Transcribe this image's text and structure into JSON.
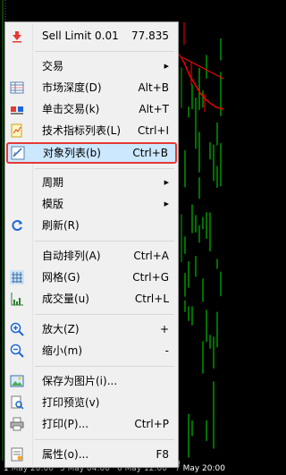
{
  "menu": {
    "items": [
      {
        "label": "Sell Limit 0.01",
        "shortcut": "77.835",
        "icon": "sell-limit-arrow-icon"
      },
      {
        "label": "交易",
        "submenu": true
      },
      {
        "label": "市场深度(D)",
        "shortcut": "Alt+B",
        "icon": "market-depth-icon"
      },
      {
        "label": "单击交易(k)",
        "shortcut": "Alt+T",
        "icon": "one-click-trading-icon"
      },
      {
        "label": "技术指标列表(L)",
        "shortcut": "Ctrl+I",
        "icon": "indicators-list-icon"
      },
      {
        "label": "对象列表(b)",
        "shortcut": "Ctrl+B",
        "icon": "objects-list-icon",
        "highlighted": true
      },
      {
        "label": "周期",
        "submenu": true
      },
      {
        "label": "模版",
        "submenu": true
      },
      {
        "label": "刷新(R)",
        "icon": "refresh-icon"
      },
      {
        "label": "自动排列(A)",
        "shortcut": "Ctrl+A"
      },
      {
        "label": "网格(G)",
        "shortcut": "Ctrl+G",
        "icon": "grid-icon"
      },
      {
        "label": "成交量(u)",
        "shortcut": "Ctrl+L",
        "icon": "volumes-icon"
      },
      {
        "label": "放大(Z)",
        "shortcut": "+",
        "icon": "zoom-in-icon"
      },
      {
        "label": "缩小(m)",
        "shortcut": "-",
        "icon": "zoom-out-icon"
      },
      {
        "label": "保存为图片(i)...",
        "icon": "save-picture-icon"
      },
      {
        "label": "打印预览(v)",
        "icon": "print-preview-icon"
      },
      {
        "label": "打印(P)...",
        "shortcut": "Ctrl+P",
        "icon": "print-icon"
      },
      {
        "label": "属性(o)...",
        "shortcut": "F8",
        "icon": "properties-icon"
      }
    ]
  },
  "chart": {
    "time_labels": [
      "1 May 20:00",
      "3 May 04:00",
      "6 May 12:00",
      "7 May 20:00"
    ],
    "colors": {
      "background": "#000000",
      "bull_candle": "#00e000",
      "bear_line": "#ff0000",
      "ma_line": "#ff0000",
      "axis_text": "#ffffff"
    }
  }
}
